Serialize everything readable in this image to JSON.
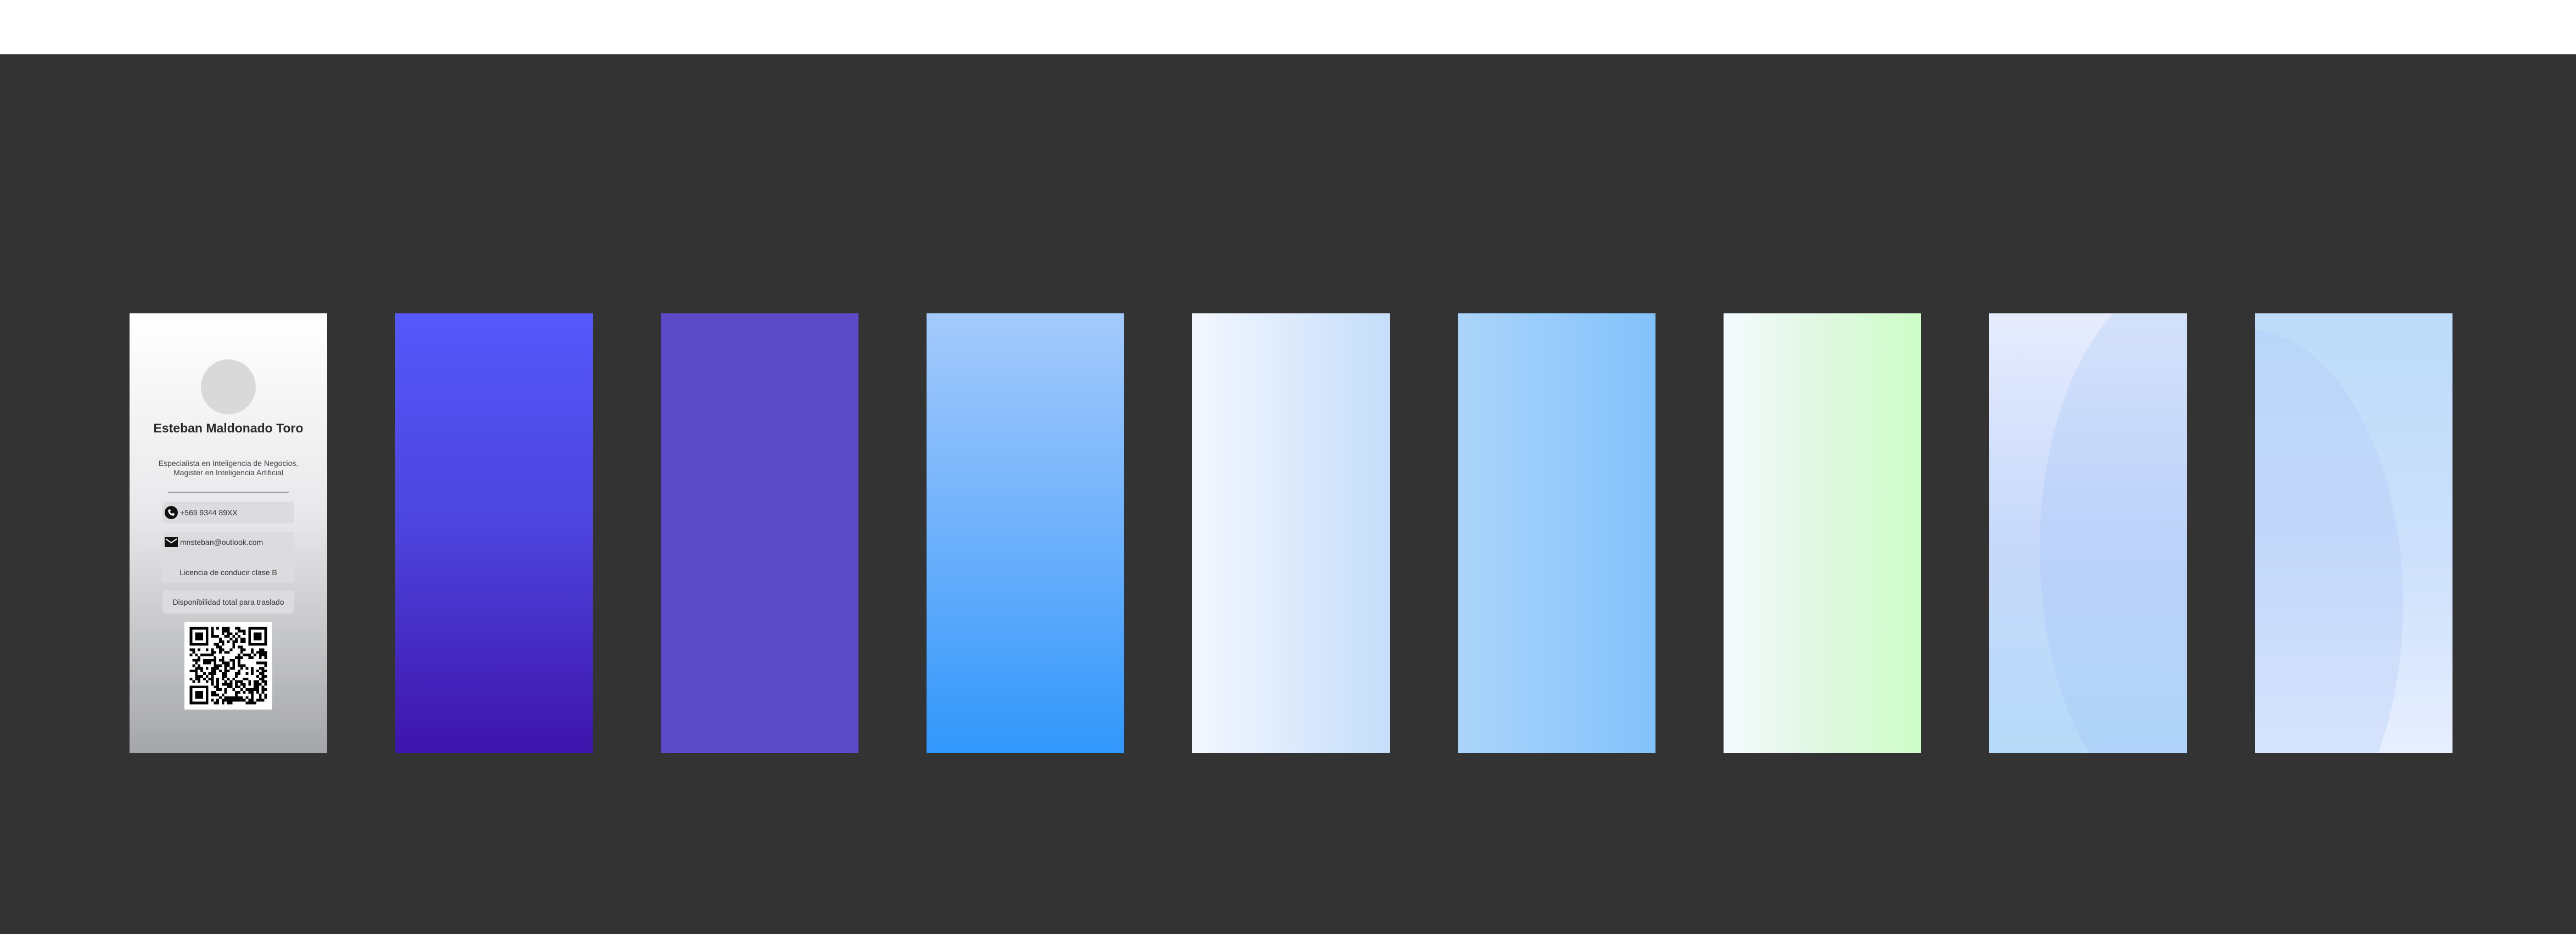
{
  "card": {
    "name": "Esteban Maldonado Toro",
    "subtitle": "Especialista en Inteligencia de Negocios, Magister en Inteligencia Artificial",
    "phone": "+569 9344 89XX",
    "email": "mnsteban@outlook.com",
    "license": "Licencia de conducir clase B",
    "availability": "Disponibilidad total para traslado",
    "icons": {
      "phone": "phone-icon",
      "email": "mail-icon",
      "qr": "qr-code"
    }
  },
  "colors": {
    "canvas": "#333333",
    "topbar": "#ffffff",
    "variant_2": [
      "#5558fb",
      "#3e14ab"
    ],
    "variant_3": "#5c4ac8",
    "variant_4": [
      "#a4cafb",
      "#3197fb"
    ],
    "variant_5": [
      "#f3f7ff",
      "#c4defa"
    ],
    "variant_6": [
      "#abd5fa",
      "#82c2fb"
    ],
    "variant_7": [
      "#f5fbff",
      "#cdfec7"
    ],
    "variant_8": [
      "#e6ecfd",
      "#b6daf9"
    ],
    "variant_9": [
      "#bcdcfa",
      "#e7efff"
    ]
  }
}
